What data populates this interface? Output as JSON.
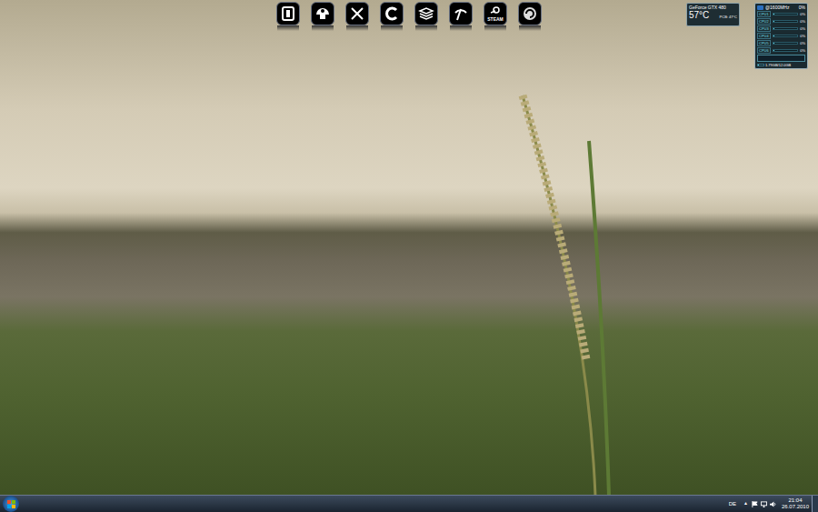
{
  "dock": {
    "steam_label": "STEAM"
  },
  "gpu_gadget": {
    "title": "GeForce GTX 480",
    "temperature": "57°C",
    "pcb": "PCB: 47°C"
  },
  "cpu_gadget": {
    "clock": "@1600MHz",
    "usage": "0%",
    "cores": [
      {
        "label": "CPU1",
        "reading": "0%",
        "level": 0.03
      },
      {
        "label": "CPU2",
        "reading": "0%",
        "level": 0.02
      },
      {
        "label": "CPU3",
        "reading": "0%",
        "level": 0.02
      },
      {
        "label": "CPU4",
        "reading": "0%",
        "level": 0.03
      },
      {
        "label": "CPU5",
        "reading": "0%",
        "level": 0.02
      },
      {
        "label": "CPU6",
        "reading": "0%",
        "level": 0.02
      }
    ],
    "memory": {
      "reading": "1.79GB/12.0GB",
      "level": 0.15
    }
  },
  "taskbar": {
    "language": "DE",
    "tray_overflow": "▲",
    "time": "21:04",
    "date": "26.07.2010"
  }
}
